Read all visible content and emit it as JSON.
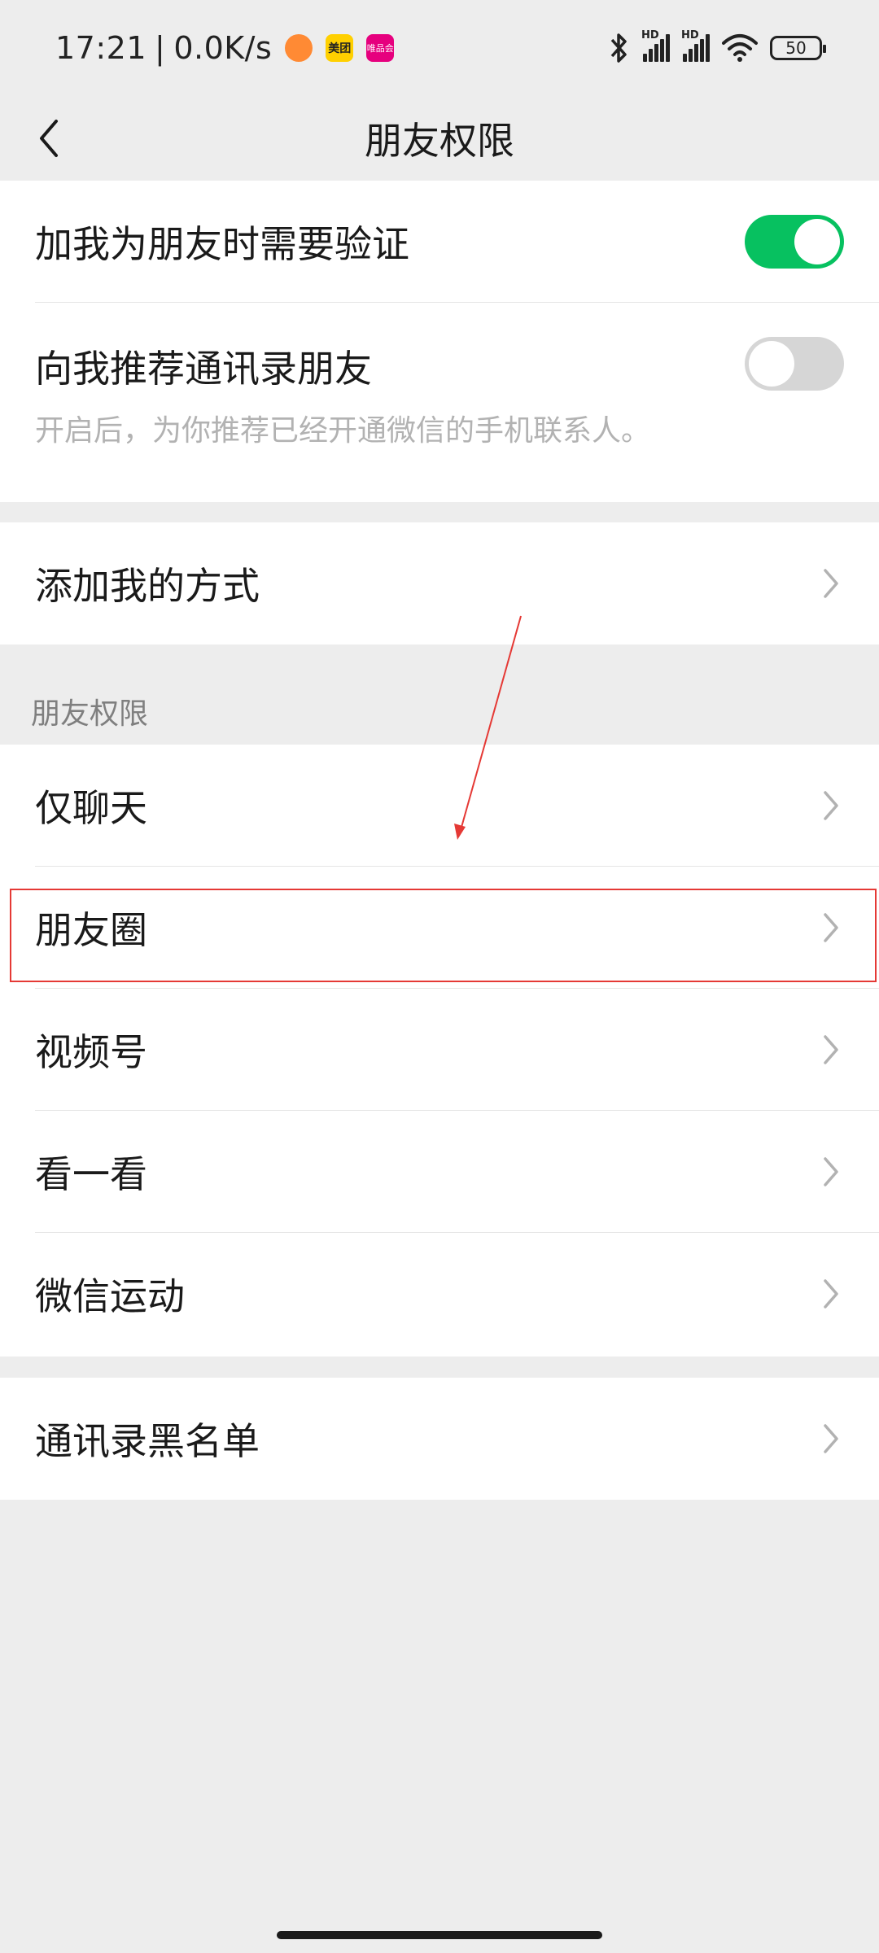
{
  "status_bar": {
    "time": "17:21",
    "separator": "|",
    "speed": "0.0K/s",
    "app_badges": [
      {
        "icon": "orange-app-icon",
        "label": ""
      },
      {
        "icon": "meituan-icon",
        "label": "美团"
      },
      {
        "icon": "vipshop-icon",
        "label": "唯品会"
      }
    ],
    "signal_hd_1": "HD",
    "signal_hd_2": "HD",
    "battery": "50"
  },
  "header": {
    "title": "朋友权限",
    "back_icon": "chevron-left-icon"
  },
  "group1": {
    "verify": {
      "label": "加我为朋友时需要验证",
      "enabled": true
    },
    "recommend": {
      "label": "向我推荐通讯录朋友",
      "enabled": false,
      "hint": "开启后，为你推荐已经开通微信的手机联系人。"
    }
  },
  "group2": {
    "add_methods": {
      "label": "添加我的方式"
    }
  },
  "section": {
    "title": "朋友权限"
  },
  "group3": {
    "items": [
      {
        "label": "仅聊天"
      },
      {
        "label": "朋友圈"
      },
      {
        "label": "视频号"
      },
      {
        "label": "看一看"
      },
      {
        "label": "微信运动"
      }
    ]
  },
  "group4": {
    "blacklist": {
      "label": "通讯录黑名单"
    }
  },
  "colors": {
    "accent_green": "#07c160",
    "toggle_off": "#d6d6d6",
    "annotation_red": "#e53935",
    "background": "#ededed"
  }
}
